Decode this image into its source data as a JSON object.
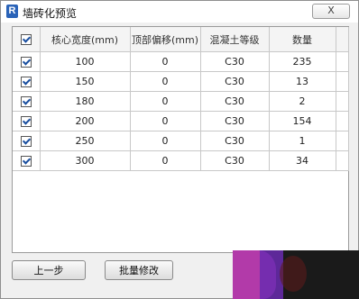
{
  "window": {
    "title": "墙砖化预览",
    "close_label": "X",
    "app_icon": "R"
  },
  "table": {
    "columns": [
      "核心宽度(mm)",
      "顶部偏移(mm)",
      "混凝土等级",
      "数量"
    ],
    "header_checked": true,
    "rows": [
      {
        "checked": true,
        "width": "100",
        "offset": "0",
        "grade": "C30",
        "count": "235"
      },
      {
        "checked": true,
        "width": "150",
        "offset": "0",
        "grade": "C30",
        "count": "13"
      },
      {
        "checked": true,
        "width": "180",
        "offset": "0",
        "grade": "C30",
        "count": "2"
      },
      {
        "checked": true,
        "width": "200",
        "offset": "0",
        "grade": "C30",
        "count": "154"
      },
      {
        "checked": true,
        "width": "250",
        "offset": "0",
        "grade": "C30",
        "count": "1"
      },
      {
        "checked": true,
        "width": "300",
        "offset": "0",
        "grade": "C30",
        "count": "34"
      }
    ]
  },
  "buttons": {
    "previous": "上一步",
    "batch_edit": "批量修改"
  }
}
